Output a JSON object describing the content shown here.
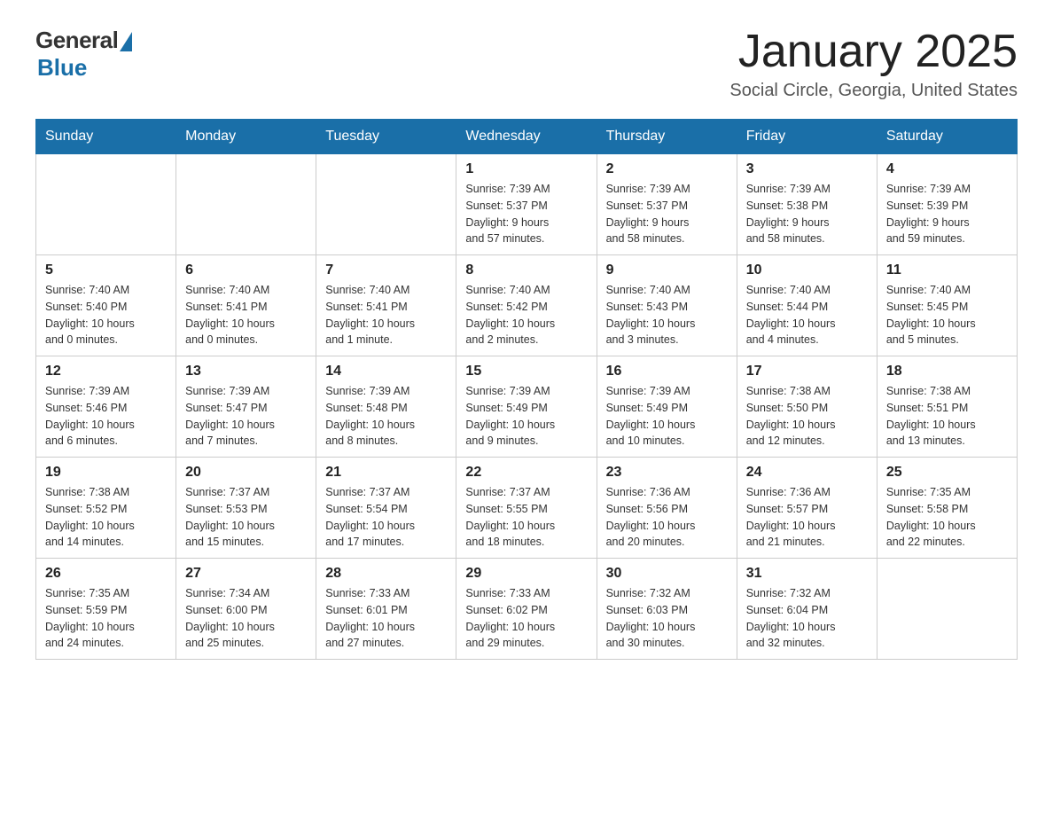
{
  "logo": {
    "general": "General",
    "blue": "Blue"
  },
  "title": "January 2025",
  "location": "Social Circle, Georgia, United States",
  "days_of_week": [
    "Sunday",
    "Monday",
    "Tuesday",
    "Wednesday",
    "Thursday",
    "Friday",
    "Saturday"
  ],
  "weeks": [
    [
      {
        "day": "",
        "info": ""
      },
      {
        "day": "",
        "info": ""
      },
      {
        "day": "",
        "info": ""
      },
      {
        "day": "1",
        "info": "Sunrise: 7:39 AM\nSunset: 5:37 PM\nDaylight: 9 hours\nand 57 minutes."
      },
      {
        "day": "2",
        "info": "Sunrise: 7:39 AM\nSunset: 5:37 PM\nDaylight: 9 hours\nand 58 minutes."
      },
      {
        "day": "3",
        "info": "Sunrise: 7:39 AM\nSunset: 5:38 PM\nDaylight: 9 hours\nand 58 minutes."
      },
      {
        "day": "4",
        "info": "Sunrise: 7:39 AM\nSunset: 5:39 PM\nDaylight: 9 hours\nand 59 minutes."
      }
    ],
    [
      {
        "day": "5",
        "info": "Sunrise: 7:40 AM\nSunset: 5:40 PM\nDaylight: 10 hours\nand 0 minutes."
      },
      {
        "day": "6",
        "info": "Sunrise: 7:40 AM\nSunset: 5:41 PM\nDaylight: 10 hours\nand 0 minutes."
      },
      {
        "day": "7",
        "info": "Sunrise: 7:40 AM\nSunset: 5:41 PM\nDaylight: 10 hours\nand 1 minute."
      },
      {
        "day": "8",
        "info": "Sunrise: 7:40 AM\nSunset: 5:42 PM\nDaylight: 10 hours\nand 2 minutes."
      },
      {
        "day": "9",
        "info": "Sunrise: 7:40 AM\nSunset: 5:43 PM\nDaylight: 10 hours\nand 3 minutes."
      },
      {
        "day": "10",
        "info": "Sunrise: 7:40 AM\nSunset: 5:44 PM\nDaylight: 10 hours\nand 4 minutes."
      },
      {
        "day": "11",
        "info": "Sunrise: 7:40 AM\nSunset: 5:45 PM\nDaylight: 10 hours\nand 5 minutes."
      }
    ],
    [
      {
        "day": "12",
        "info": "Sunrise: 7:39 AM\nSunset: 5:46 PM\nDaylight: 10 hours\nand 6 minutes."
      },
      {
        "day": "13",
        "info": "Sunrise: 7:39 AM\nSunset: 5:47 PM\nDaylight: 10 hours\nand 7 minutes."
      },
      {
        "day": "14",
        "info": "Sunrise: 7:39 AM\nSunset: 5:48 PM\nDaylight: 10 hours\nand 8 minutes."
      },
      {
        "day": "15",
        "info": "Sunrise: 7:39 AM\nSunset: 5:49 PM\nDaylight: 10 hours\nand 9 minutes."
      },
      {
        "day": "16",
        "info": "Sunrise: 7:39 AM\nSunset: 5:49 PM\nDaylight: 10 hours\nand 10 minutes."
      },
      {
        "day": "17",
        "info": "Sunrise: 7:38 AM\nSunset: 5:50 PM\nDaylight: 10 hours\nand 12 minutes."
      },
      {
        "day": "18",
        "info": "Sunrise: 7:38 AM\nSunset: 5:51 PM\nDaylight: 10 hours\nand 13 minutes."
      }
    ],
    [
      {
        "day": "19",
        "info": "Sunrise: 7:38 AM\nSunset: 5:52 PM\nDaylight: 10 hours\nand 14 minutes."
      },
      {
        "day": "20",
        "info": "Sunrise: 7:37 AM\nSunset: 5:53 PM\nDaylight: 10 hours\nand 15 minutes."
      },
      {
        "day": "21",
        "info": "Sunrise: 7:37 AM\nSunset: 5:54 PM\nDaylight: 10 hours\nand 17 minutes."
      },
      {
        "day": "22",
        "info": "Sunrise: 7:37 AM\nSunset: 5:55 PM\nDaylight: 10 hours\nand 18 minutes."
      },
      {
        "day": "23",
        "info": "Sunrise: 7:36 AM\nSunset: 5:56 PM\nDaylight: 10 hours\nand 20 minutes."
      },
      {
        "day": "24",
        "info": "Sunrise: 7:36 AM\nSunset: 5:57 PM\nDaylight: 10 hours\nand 21 minutes."
      },
      {
        "day": "25",
        "info": "Sunrise: 7:35 AM\nSunset: 5:58 PM\nDaylight: 10 hours\nand 22 minutes."
      }
    ],
    [
      {
        "day": "26",
        "info": "Sunrise: 7:35 AM\nSunset: 5:59 PM\nDaylight: 10 hours\nand 24 minutes."
      },
      {
        "day": "27",
        "info": "Sunrise: 7:34 AM\nSunset: 6:00 PM\nDaylight: 10 hours\nand 25 minutes."
      },
      {
        "day": "28",
        "info": "Sunrise: 7:33 AM\nSunset: 6:01 PM\nDaylight: 10 hours\nand 27 minutes."
      },
      {
        "day": "29",
        "info": "Sunrise: 7:33 AM\nSunset: 6:02 PM\nDaylight: 10 hours\nand 29 minutes."
      },
      {
        "day": "30",
        "info": "Sunrise: 7:32 AM\nSunset: 6:03 PM\nDaylight: 10 hours\nand 30 minutes."
      },
      {
        "day": "31",
        "info": "Sunrise: 7:32 AM\nSunset: 6:04 PM\nDaylight: 10 hours\nand 32 minutes."
      },
      {
        "day": "",
        "info": ""
      }
    ]
  ]
}
